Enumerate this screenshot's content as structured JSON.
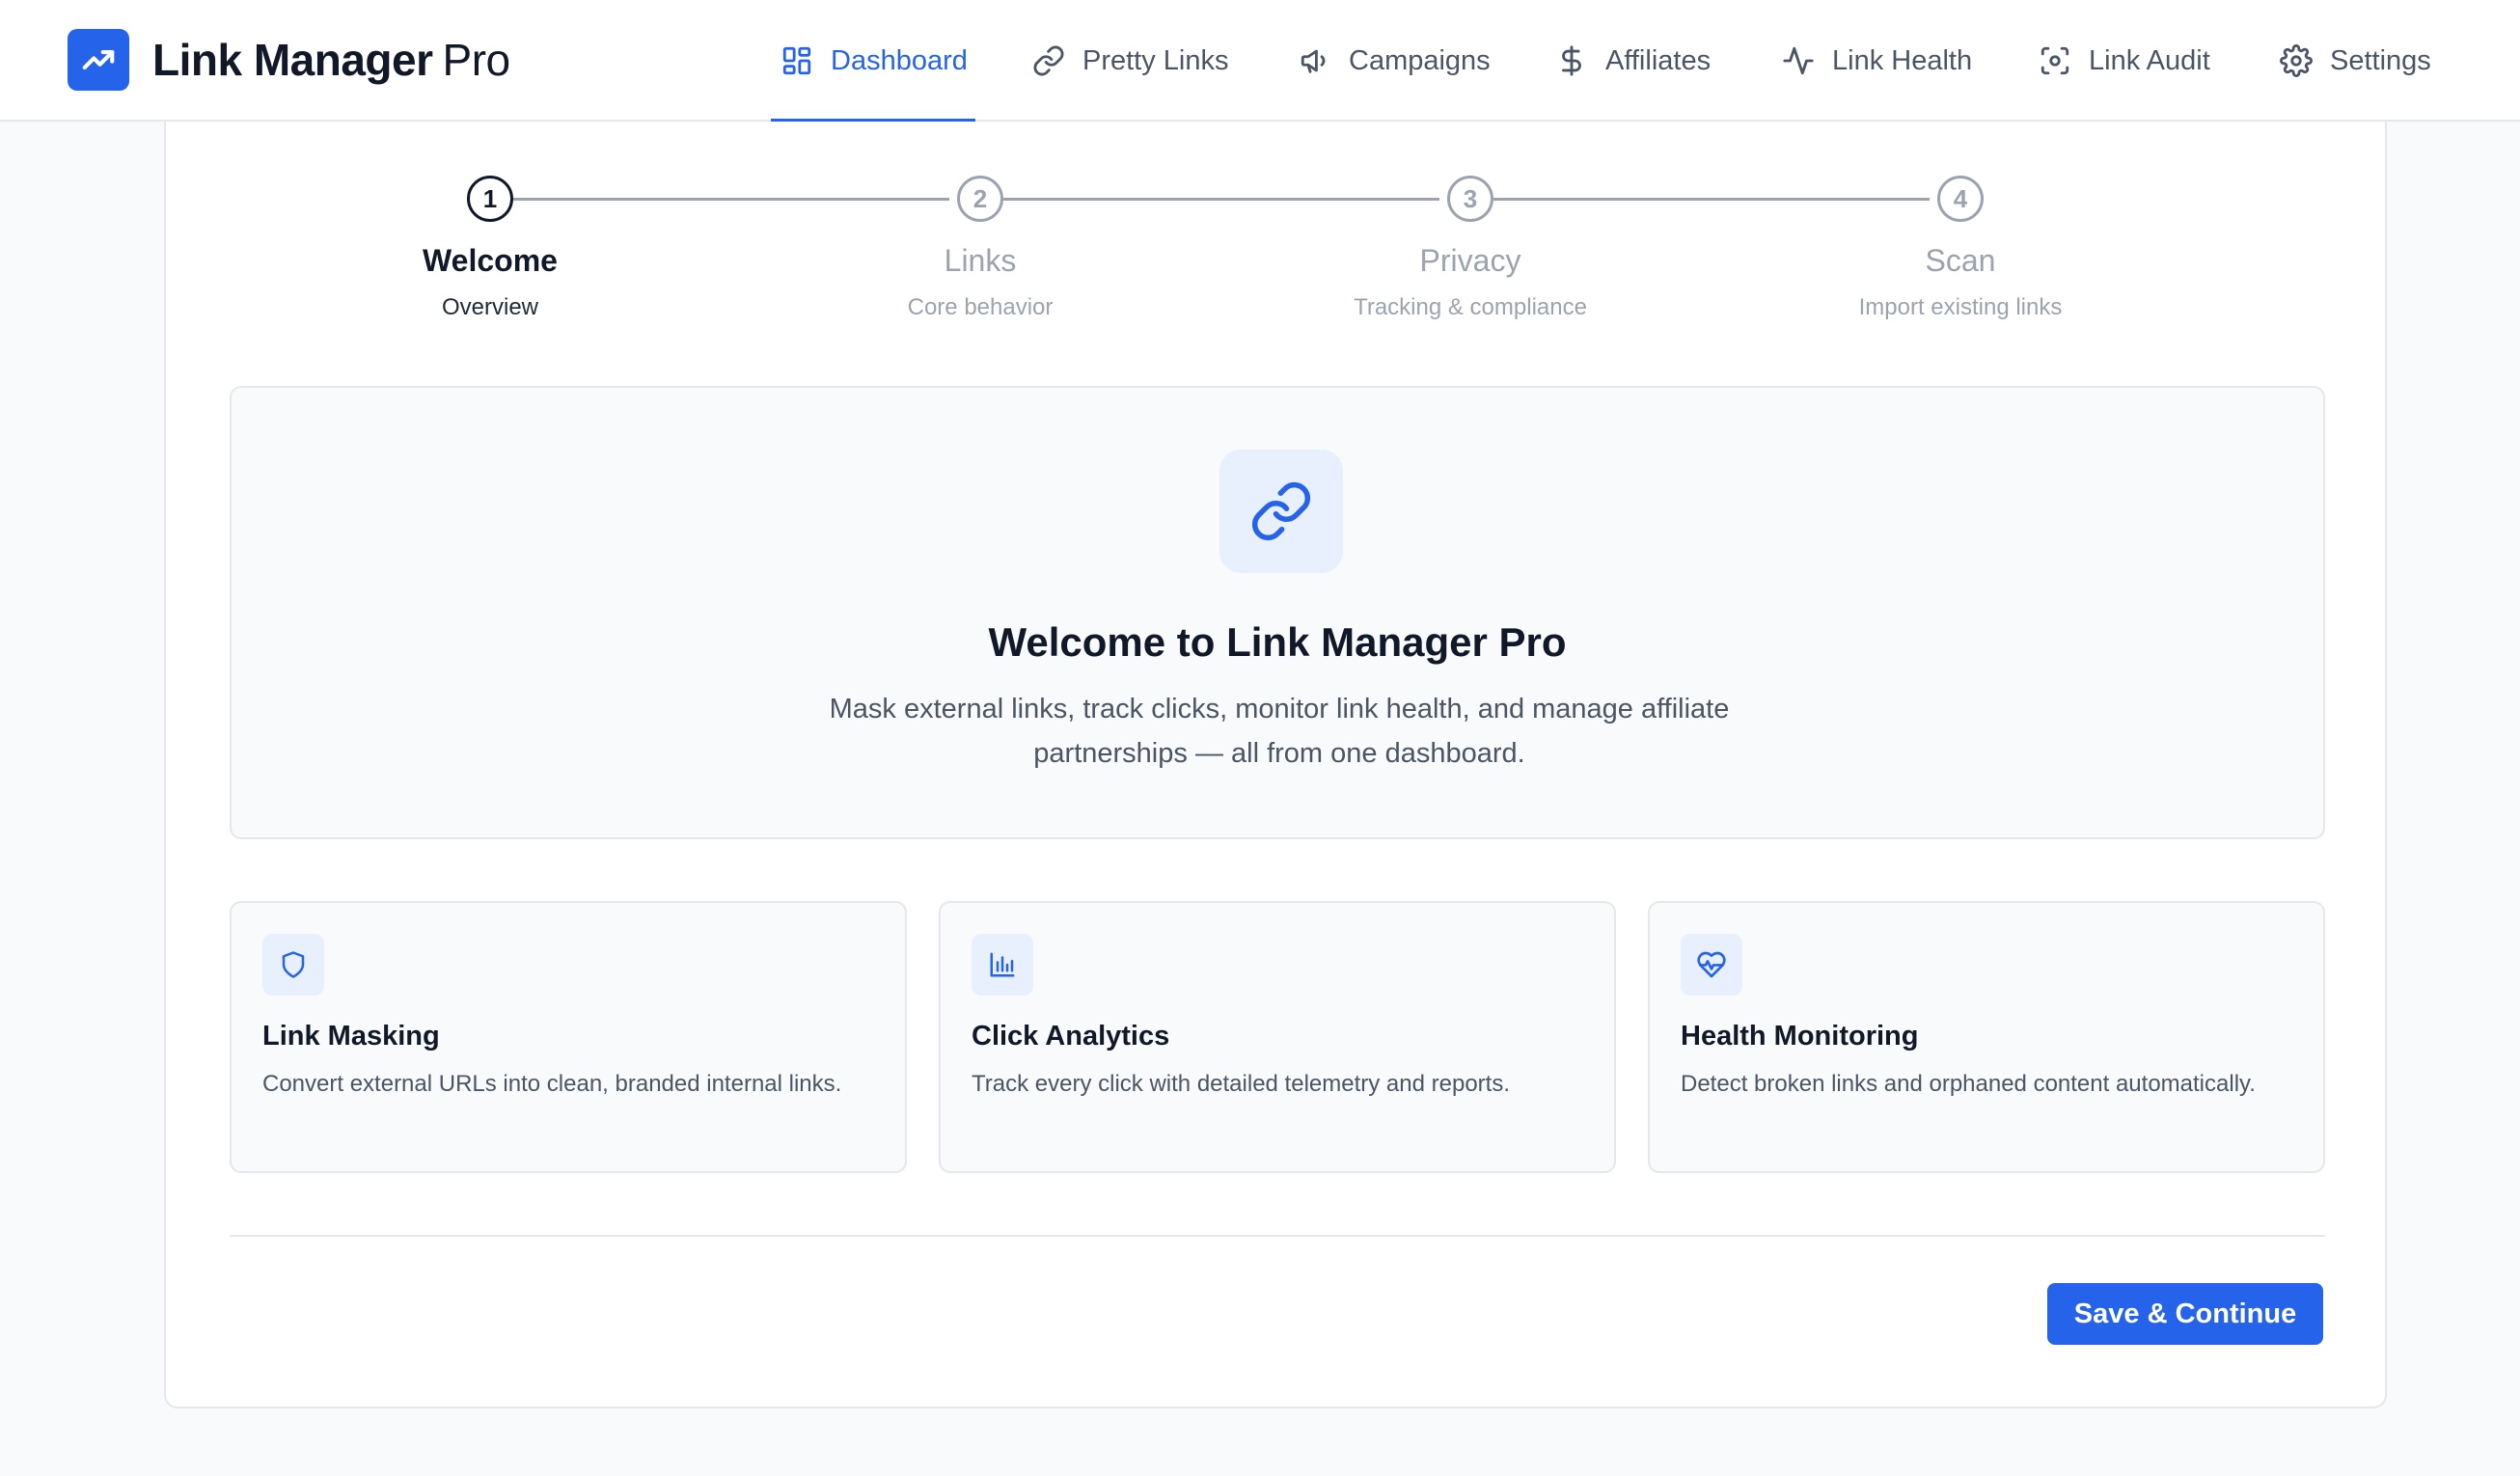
{
  "brand": {
    "name_strong": "Link Manager",
    "name_light": "Pro",
    "logo_icon": "trending-up-icon",
    "color": "#2563eb"
  },
  "nav": {
    "items": [
      {
        "label": "Dashboard",
        "icon": "grid-icon",
        "active": true
      },
      {
        "label": "Pretty Links",
        "icon": "link-icon"
      },
      {
        "label": "Campaigns",
        "icon": "megaphone-icon"
      },
      {
        "label": "Affiliates",
        "icon": "dollar-icon"
      },
      {
        "label": "Link Health",
        "icon": "activity-icon"
      },
      {
        "label": "Link Audit",
        "icon": "scan-icon"
      },
      {
        "label": "Settings",
        "icon": "gear-icon"
      }
    ]
  },
  "steps": [
    {
      "number": "1",
      "title": "Welcome",
      "subtitle": "Overview",
      "active": true
    },
    {
      "number": "2",
      "title": "Links",
      "subtitle": "Core behavior"
    },
    {
      "number": "3",
      "title": "Privacy",
      "subtitle": "Tracking & compliance"
    },
    {
      "number": "4",
      "title": "Scan",
      "subtitle": "Import existing links"
    }
  ],
  "hero": {
    "icon": "link-icon",
    "title": "Welcome to Link Manager Pro",
    "description": "Mask external links, track clicks, monitor link health, and manage affiliate partnerships — all from one dashboard."
  },
  "features": [
    {
      "icon": "shield-icon",
      "title": "Link Masking",
      "description": "Convert external URLs into clean, branded internal links."
    },
    {
      "icon": "bar-chart-icon",
      "title": "Click Analytics",
      "description": "Track every click with detailed telemetry and reports."
    },
    {
      "icon": "heart-pulse-icon",
      "title": "Health Monitoring",
      "description": "Detect broken links and orphaned content automatically."
    }
  ],
  "actions": {
    "save_label": "Save & Continue"
  },
  "colors": {
    "accent": "#2563eb",
    "accent_soft": "#e8effd",
    "muted": "#9ca3af"
  }
}
